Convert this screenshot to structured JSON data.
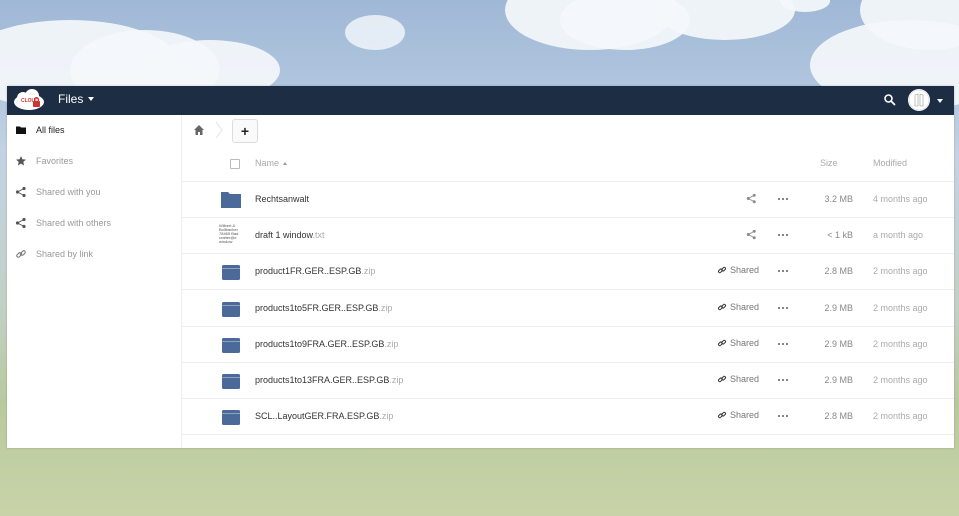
{
  "header": {
    "app_name": "Files",
    "logo_icon": "cloud-lock-logo-icon",
    "search_icon": "search-icon",
    "avatar_icon": "avatar-icon"
  },
  "sidebar": {
    "items": [
      {
        "label": "All files",
        "icon": "folder-icon",
        "active": true
      },
      {
        "label": "Favorites",
        "icon": "star-icon",
        "active": false
      },
      {
        "label": "Shared with you",
        "icon": "share-icon",
        "active": false
      },
      {
        "label": "Shared with others",
        "icon": "share-icon",
        "active": false
      },
      {
        "label": "Shared by link",
        "icon": "link-icon",
        "active": false
      }
    ]
  },
  "toolbar": {
    "new_label": "+",
    "home_icon": "home-icon"
  },
  "table": {
    "columns": {
      "name": "Name",
      "size": "Size",
      "modified": "Modified"
    },
    "rows": [
      {
        "name": "Rechtsanwalt",
        "ext": "",
        "type": "folder",
        "shared": "",
        "size": "3.2 MB",
        "modified": "4 months ago"
      },
      {
        "name": "draft 1 window",
        "ext": ".txt",
        "type": "text",
        "shared": "",
        "size": "< 1 kB",
        "modified": "a month ago",
        "thumb_lines": [
          "Wilbert &",
          "Bollbacher",
          "78465 Bad",
          "cratter@e",
          "window"
        ]
      },
      {
        "name": "product1FR.GER..ESP.GB",
        "ext": ".zip",
        "type": "zip",
        "shared": "Shared",
        "size": "2.8 MB",
        "modified": "2 months ago"
      },
      {
        "name": "products1to5FR.GER..ESP.GB",
        "ext": ".zip",
        "type": "zip",
        "shared": "Shared",
        "size": "2.9 MB",
        "modified": "2 months ago"
      },
      {
        "name": "products1to9FRA.GER..ESP.GB",
        "ext": ".zip",
        "type": "zip",
        "shared": "Shared",
        "size": "2.9 MB",
        "modified": "2 months ago"
      },
      {
        "name": "products1to13FRA.GER..ESP.GB",
        "ext": ".zip",
        "type": "zip",
        "shared": "Shared",
        "size": "2.9 MB",
        "modified": "2 months ago"
      },
      {
        "name": "SCL..LayoutGER.FRA.ESP.GB",
        "ext": ".zip",
        "type": "zip",
        "shared": "Shared",
        "size": "2.8 MB",
        "modified": "2 months ago"
      }
    ]
  },
  "colors": {
    "header_bg": "#1d2d44",
    "folder_blue": "#4b6a99",
    "logo_red": "#d2322d"
  }
}
